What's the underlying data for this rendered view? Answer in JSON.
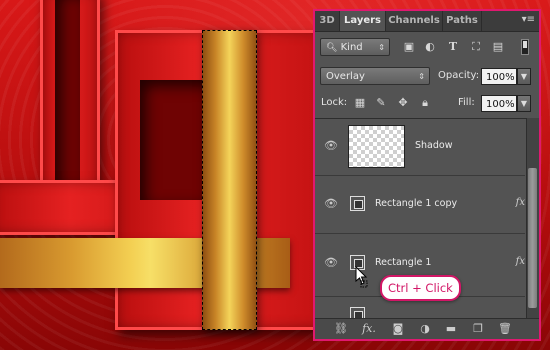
{
  "panel": {
    "tabs": [
      {
        "label": "3D",
        "active": false
      },
      {
        "label": "Layers",
        "active": true
      },
      {
        "label": "Channels",
        "active": false
      },
      {
        "label": "Paths",
        "active": false
      }
    ],
    "filter_kind": "Kind",
    "blend_mode": "Overlay",
    "opacity_label": "Opacity:",
    "opacity_value": "100%",
    "lock_label": "Lock:",
    "fill_label": "Fill:",
    "fill_value": "100%",
    "layers": [
      {
        "name": "Shadow",
        "has_fx": false,
        "thumbnail": "transparent-checker"
      },
      {
        "name": "Rectangle 1 copy",
        "has_fx": true,
        "fx_label": "fx",
        "thumbnail": "shape-icon"
      },
      {
        "name": "Rectangle 1",
        "has_fx": true,
        "fx_label": "fx",
        "thumbnail": "shape-icon"
      }
    ]
  },
  "tooltip": {
    "text": "Ctrl + Click"
  },
  "colors": {
    "highlight": "#d21666",
    "panel_bg": "#535353",
    "canvas_red": "#c81010",
    "ribbon_gold": "#f3cf52"
  },
  "icons": {
    "filter": [
      "pixel-filter-icon",
      "adjustment-filter-icon",
      "type-filter-icon",
      "shape-filter-icon",
      "smart-object-filter-icon"
    ],
    "lock": [
      "lock-transparent-icon",
      "lock-image-icon",
      "lock-position-icon",
      "lock-all-icon"
    ],
    "footer": [
      "link-layers-icon",
      "add-fx-icon",
      "add-mask-icon",
      "new-adjustment-icon",
      "new-group-icon",
      "new-layer-icon",
      "delete-layer-icon"
    ]
  }
}
